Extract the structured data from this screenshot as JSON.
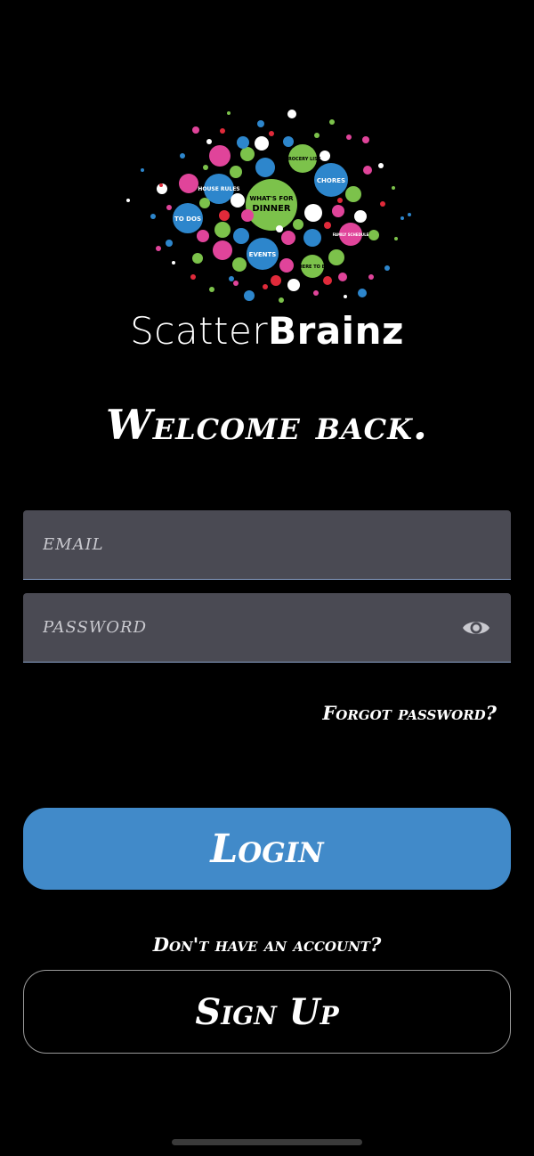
{
  "logo": {
    "bubble_labels": {
      "grocery": "GROCERY LIST",
      "house": "HOUSE RULES",
      "chores": "CHORES",
      "dinner_1": "WHAT'S FOR",
      "dinner_2": "DINNER",
      "todos": "TO DOS",
      "family": "FAMILY SCHEDULE",
      "events": "EVENTS",
      "where": "WHERE TO EAT"
    },
    "brand_light": "Scatter",
    "brand_bold": "Brainz"
  },
  "heading": "Welcome back.",
  "form": {
    "email_placeholder": "EMAIL",
    "password_placeholder": "PASSWORD",
    "forgot_label": "Forgot password?"
  },
  "login_label": "Login",
  "no_account_label": "Don't have an account?",
  "signup_label": "Sign Up",
  "icons": {
    "password_toggle": "eye-icon"
  },
  "colors": {
    "background": "#000000",
    "field": "#4a4a53",
    "primary": "#418ac9",
    "logo_blue": "#2d86cc",
    "logo_green": "#7cc24b",
    "logo_pink": "#e0449a",
    "logo_red": "#e02a3a"
  }
}
